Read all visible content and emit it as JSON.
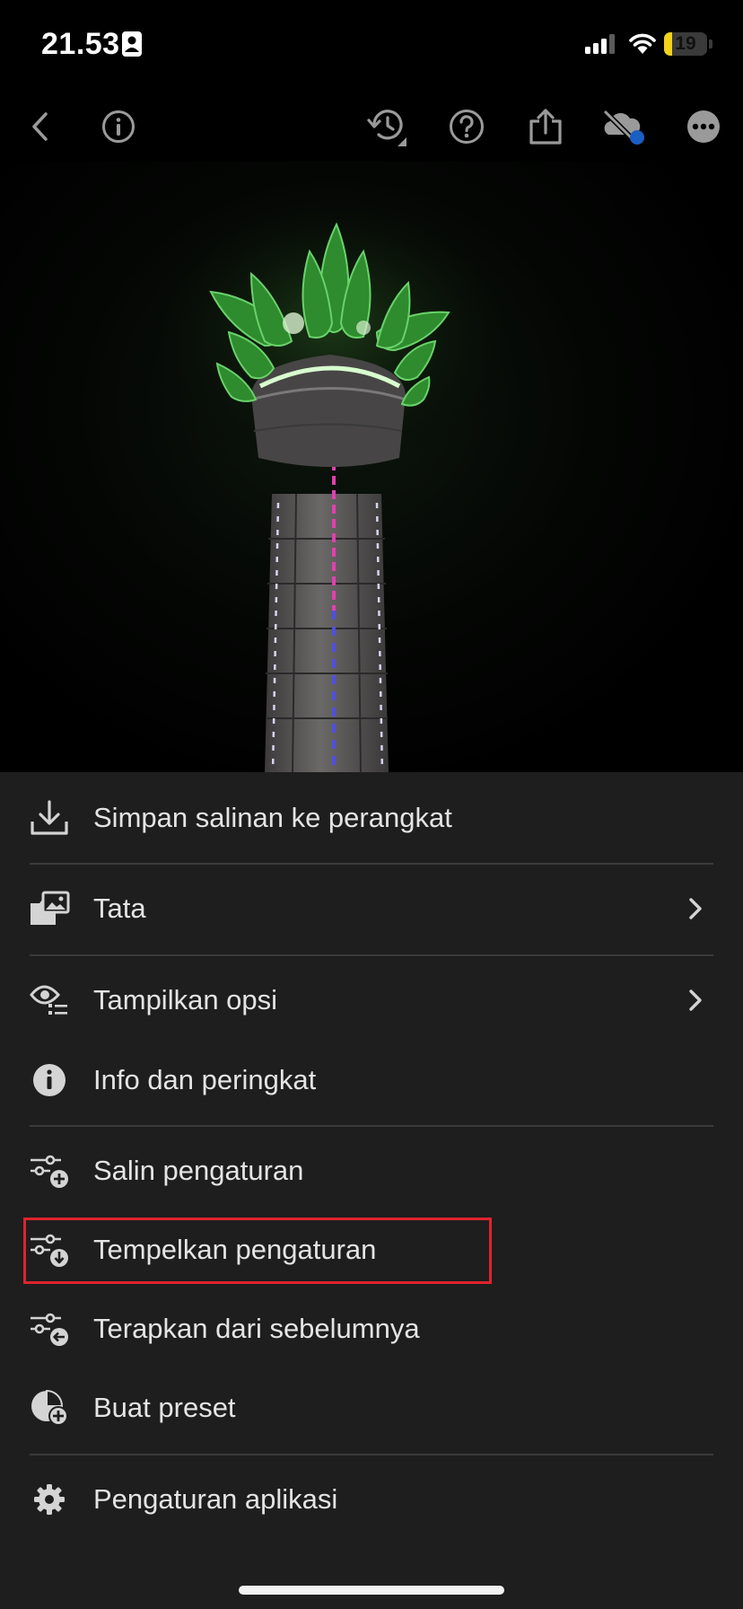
{
  "status_bar": {
    "time": "21.53",
    "battery": "19",
    "battery_level": 0.19
  },
  "toolbar": {
    "icons": [
      "back-icon",
      "info-icon",
      "history-icon",
      "help-icon",
      "share-icon",
      "cloud-sync-off-icon",
      "more-icon"
    ]
  },
  "menu": {
    "items": [
      {
        "label": "Simpan salinan ke perangkat",
        "icon": "download-icon"
      },
      {
        "label": "Tata",
        "icon": "organize-icon"
      },
      {
        "label": "Tampilkan opsi",
        "icon": "view-options-icon"
      },
      {
        "label": "Info dan peringkat",
        "icon": "info-circle-icon"
      },
      {
        "label": "Salin pengaturan",
        "icon": "copy-settings-icon"
      },
      {
        "label": "Tempelkan pengaturan",
        "icon": "paste-settings-icon"
      },
      {
        "label": "Terapkan dari sebelumnya",
        "icon": "apply-previous-icon"
      },
      {
        "label": "Buat preset",
        "icon": "create-preset-icon"
      },
      {
        "label": "Pengaturan aplikasi",
        "icon": "gear-icon"
      }
    ]
  },
  "colors": {
    "sheet_background": "#1e1e1e",
    "highlight": "#e0232e",
    "cloud_badge": "#1a5fc4"
  }
}
